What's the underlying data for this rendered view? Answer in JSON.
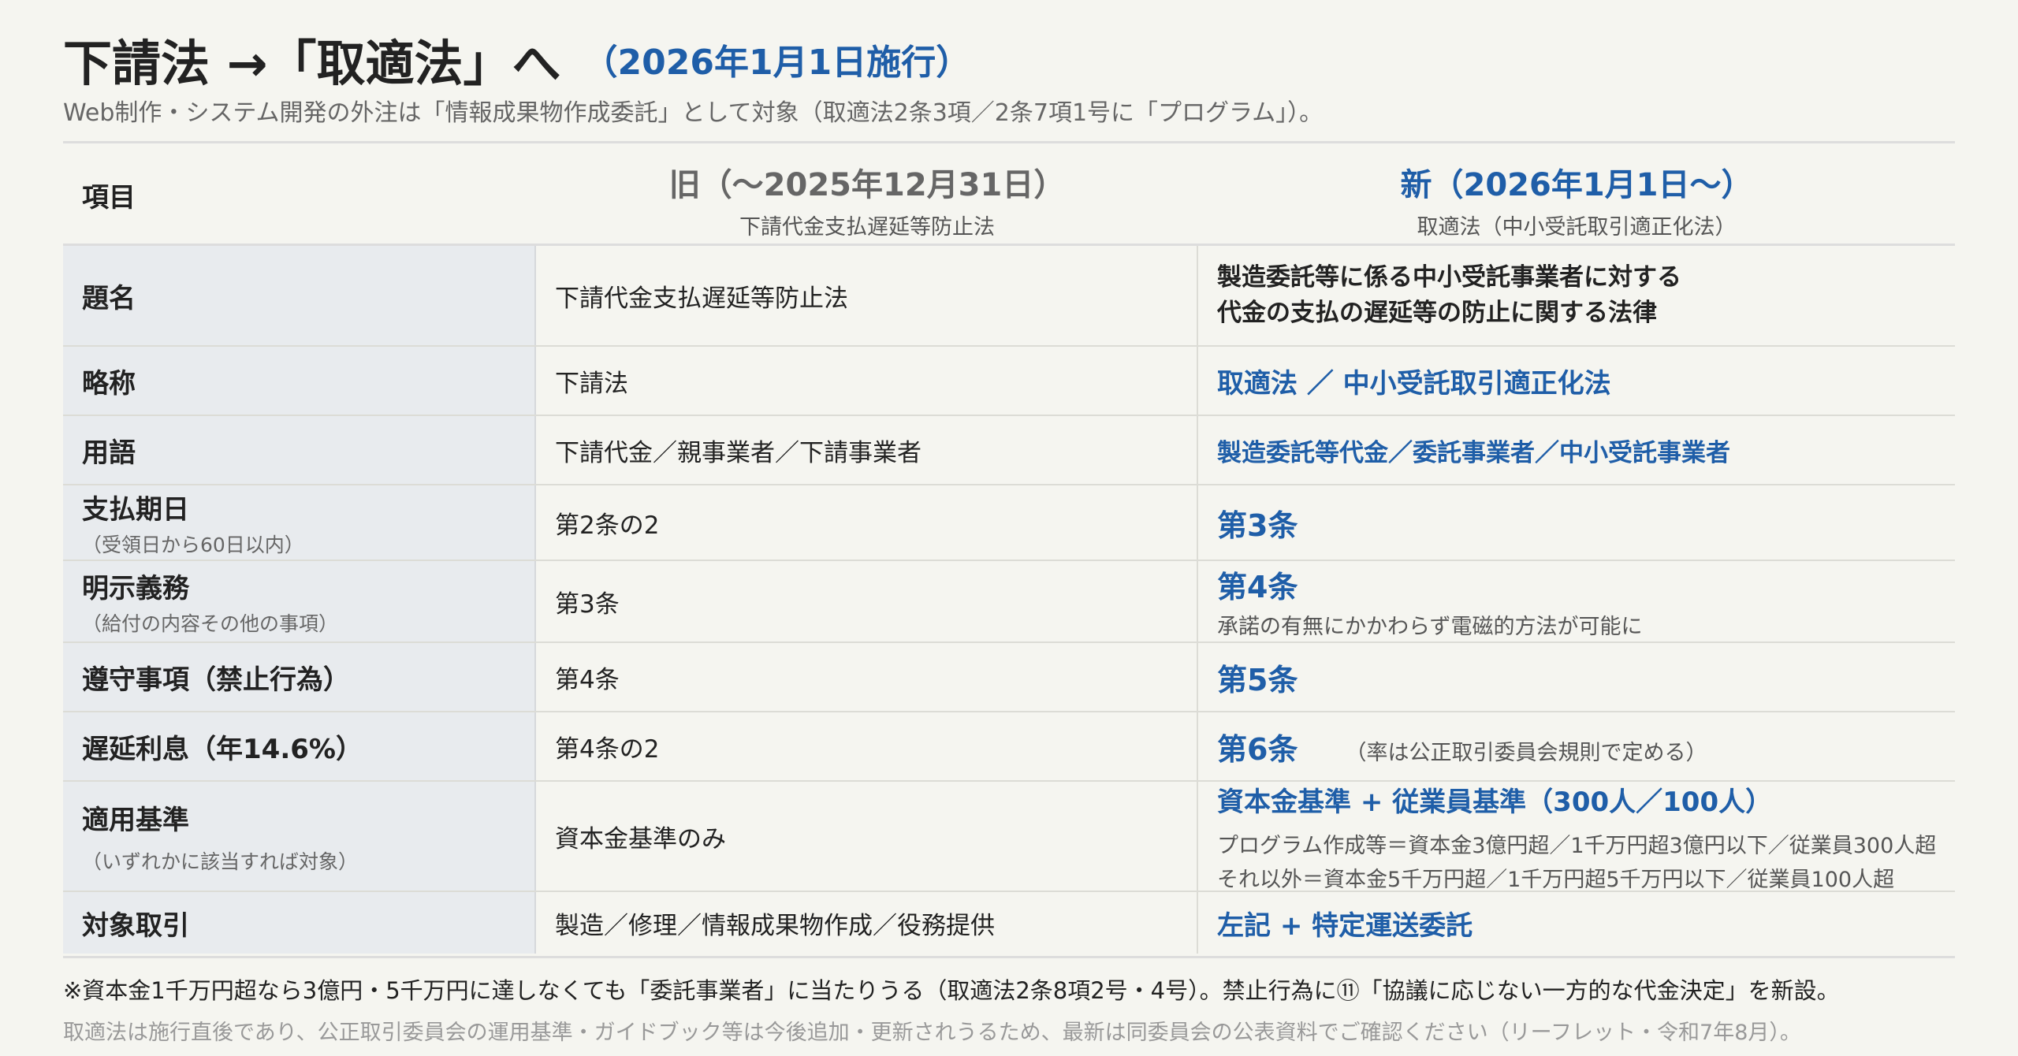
{
  "title": {
    "main": "下請法 →「取適法」へ",
    "date": "（2026年1月1日施行）"
  },
  "subtitle": "Web制作・システム開発の外注は「情報成果物作成委託」として対象（取適法2条3項／2条7項1号に「プログラム」）。",
  "header": {
    "item": "項目",
    "old_main": "旧（〜2025年12月31日）",
    "old_sub": "下請代金支払遅延等防止法",
    "new_main": "新（2026年1月1日〜）",
    "new_sub": "取適法（中小受託取引適正化法）"
  },
  "rows": [
    {
      "label": "題名",
      "old": "下請代金支払遅延等防止法",
      "new_line1": "製造委託等に係る中小受託事業者に対する",
      "new_line2": "代金の支払の遅延等の防止に関する法律"
    },
    {
      "label": "略称",
      "old": "下請法",
      "new": "取適法 ／ 中小受託取引適正化法"
    },
    {
      "label": "用語",
      "old": "下請代金／親事業者／下請事業者",
      "new": "製造委託等代金／委託事業者／中小受託事業者"
    },
    {
      "label": "支払期日",
      "label_sub": "（受領日から60日以内）",
      "old": "第2条の2",
      "new": "第3条"
    },
    {
      "label": "明示義務",
      "label_sub": "（給付の内容その他の事項）",
      "old": "第3条",
      "new": "第4条",
      "new_note": "承諾の有無にかかわらず電磁的方法が可能に"
    },
    {
      "label": "遵守事項（禁止行為）",
      "old": "第4条",
      "new": "第5条"
    },
    {
      "label": "遅延利息（年14.6%）",
      "old": "第4条の2",
      "new": "第6条",
      "new_note": "（率は公正取引委員会規則で定める）"
    },
    {
      "label": "適用基準",
      "label_sub": "（いずれかに該当すれば対象）",
      "old": "資本金基準のみ",
      "new": "資本金基準 + 従業員基準（300人／100人）",
      "new_note1": "プログラム作成等＝資本金3億円超／1千万円超3億円以下／従業員300人超",
      "new_note2": "それ以外＝資本金5千万円超／1千万円超5千万円以下／従業員100人超"
    },
    {
      "label": "対象取引",
      "old": "製造／修理／情報成果物作成／役務提供",
      "new": "左記 + 特定運送委託"
    }
  ],
  "footnote1": "※資本金1千万円超なら3億円・5千万円に達しなくても「委託事業者」に当たりうる（取適法2条8項2号・4号）。禁止行為に⑪「協議に応じない一方的な代金決定」を新設。",
  "footnote2": "取適法は施行直後であり、公正取引委員会の運用基準・ガイドブック等は今後追加・更新されうるため、最新は同委員会の公表資料でご確認ください（リーフレット・令和7年8月）。",
  "colors": {
    "accent": "#1f5ea8",
    "label_bg": "#e8ebee",
    "page_bg": "#f5f5f0"
  }
}
